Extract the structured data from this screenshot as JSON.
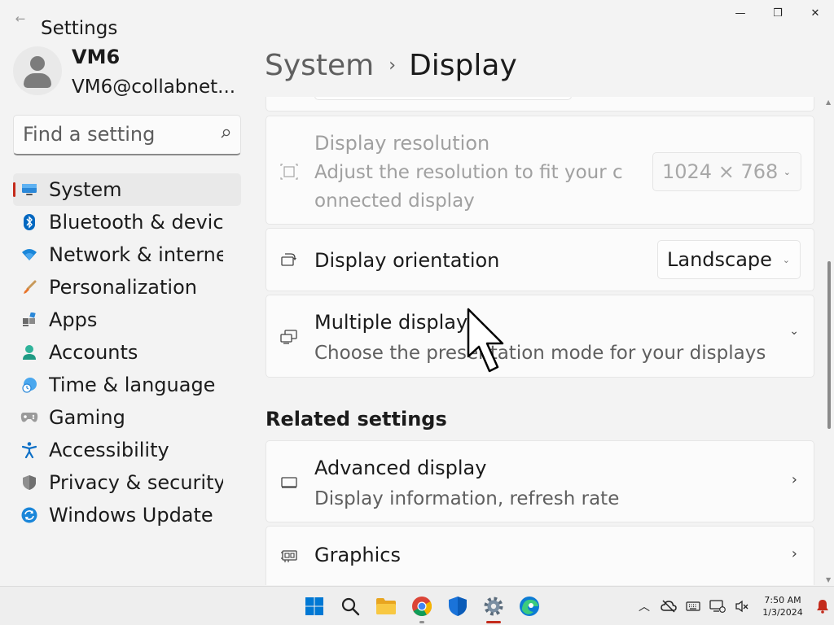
{
  "window": {
    "title": "Settings",
    "back_glyph": "←",
    "controls": {
      "minimize": "—",
      "maximize": "❒",
      "close": "✕"
    }
  },
  "user": {
    "name": "VM6",
    "email": "VM6@collabnet..."
  },
  "search": {
    "placeholder": "Find a setting",
    "value": ""
  },
  "nav": {
    "items": [
      {
        "label": "System",
        "icon": "monitor-icon",
        "active": true
      },
      {
        "label": "Bluetooth & devices",
        "icon": "bluetooth-icon"
      },
      {
        "label": "Network & internet",
        "icon": "wifi-icon"
      },
      {
        "label": "Personalization",
        "icon": "brush-icon"
      },
      {
        "label": "Apps",
        "icon": "apps-icon"
      },
      {
        "label": "Accounts",
        "icon": "person-icon"
      },
      {
        "label": "Time & language",
        "icon": "globe-clock-icon"
      },
      {
        "label": "Gaming",
        "icon": "gamepad-icon"
      },
      {
        "label": "Accessibility",
        "icon": "accessibility-icon"
      },
      {
        "label": "Privacy & security",
        "icon": "shield-icon"
      },
      {
        "label": "Windows Update",
        "icon": "update-icon"
      }
    ]
  },
  "breadcrumb": {
    "parent": "System",
    "separator": "›",
    "current": "Display"
  },
  "main": {
    "resolution": {
      "title": "Display resolution",
      "subtitle_line1": "Adjust the resolution to fit your c",
      "subtitle_line2": "onnected display",
      "value": "1024 × 768",
      "disabled": true
    },
    "orientation": {
      "title": "Display orientation",
      "value": "Landscape"
    },
    "multiple": {
      "title": "Multiple displays",
      "subtitle": "Choose the presentation mode for your displays"
    },
    "related_heading": "Related settings",
    "advanced": {
      "title": "Advanced display",
      "subtitle": "Display information, refresh rate"
    },
    "graphics": {
      "title": "Graphics"
    },
    "chevron_down": "⌄",
    "chevron_right": "›",
    "combo_chevron": "⌄"
  },
  "taskbar": {
    "apps": [
      {
        "name": "start-button",
        "icon": "windows-logo-icon"
      },
      {
        "name": "search-button",
        "icon": "search-icon"
      },
      {
        "name": "file-explorer",
        "icon": "folder-icon",
        "running": false
      },
      {
        "name": "chrome",
        "icon": "chrome-icon",
        "running": true
      },
      {
        "name": "defender",
        "icon": "shield-icon",
        "running": false
      },
      {
        "name": "settings",
        "icon": "gear-icon",
        "running": true,
        "active": true
      },
      {
        "name": "edge",
        "icon": "edge-icon",
        "running": false
      }
    ],
    "clock": {
      "time": "7:50 AM",
      "date": "1/3/2024"
    }
  },
  "colors": {
    "accent": "#c42b1c",
    "windows_blue": "#0078d4",
    "background": "#f3f3f3"
  }
}
